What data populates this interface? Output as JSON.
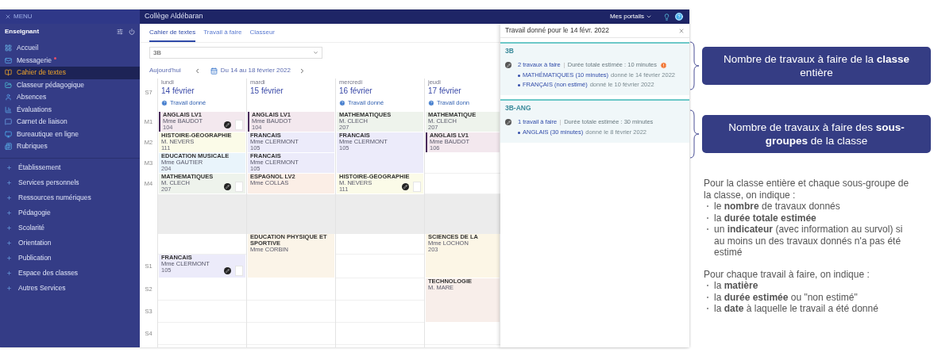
{
  "menu_button": "MENU",
  "school": "Collège Aldébaran",
  "portals": "Mes portails",
  "sidebar": {
    "role": "Enseignant",
    "items": [
      {
        "label": "Accueil",
        "selected": false,
        "badge": false
      },
      {
        "label": "Messagerie",
        "selected": false,
        "badge": true
      },
      {
        "label": "Cahier de textes",
        "selected": true,
        "badge": false
      },
      {
        "label": "Classeur pédagogique",
        "selected": false,
        "badge": false
      },
      {
        "label": "Absences",
        "selected": false,
        "badge": false
      },
      {
        "label": "Évaluations",
        "selected": false,
        "badge": false
      },
      {
        "label": "Carnet de liaison",
        "selected": false,
        "badge": false
      },
      {
        "label": "Bureautique en ligne",
        "selected": false,
        "badge": false
      },
      {
        "label": "Rubriques",
        "selected": false,
        "badge": false
      }
    ],
    "sections": [
      {
        "label": "Établissement",
        "expanded": false
      },
      {
        "label": "Services personnels",
        "expanded": false
      },
      {
        "label": "Ressources numériques",
        "expanded": false
      },
      {
        "label": "Pédagogie",
        "expanded": false
      },
      {
        "label": "Scolarité",
        "expanded": false
      },
      {
        "label": "Orientation",
        "expanded": false
      },
      {
        "label": "Publication",
        "expanded": false
      },
      {
        "label": "Espace des classes",
        "expanded": false
      },
      {
        "label": "Autres Services",
        "expanded": false
      }
    ]
  },
  "tabs": [
    {
      "label": "Cahier de textes",
      "selected": true
    },
    {
      "label": "Travail à faire",
      "selected": false
    },
    {
      "label": "Classeur",
      "selected": false
    }
  ],
  "class_select": {
    "value": "3B"
  },
  "nav": {
    "today": "Aujourd'hui",
    "range": "Du 14 au 18 février 2022"
  },
  "calendar": {
    "week": "S7",
    "times": [
      "M1",
      "M2",
      "M3",
      "M4",
      "S1",
      "S2",
      "S3",
      "S4"
    ],
    "days": [
      {
        "weekday": "lundi",
        "date": "14 février",
        "work_link": "Travail donné",
        "cells": [
          {
            "kind": "course",
            "subject": "ANGLAIS LV1",
            "teacher": "Mme BAUDOT",
            "room": "104",
            "color": "#f3e8ee",
            "subgroup": true,
            "homework": true,
            "long": false
          },
          {
            "kind": "course",
            "subject": "HISTOIRE-GÉOGRAPHIE",
            "teacher": "M. NEVERS",
            "room": "111",
            "color": "#fbfbe8",
            "subgroup": false,
            "homework": false,
            "long": false
          },
          {
            "kind": "course",
            "subject": "EDUCATION MUSICALE",
            "teacher": "Mme GAUTIER",
            "room": "204",
            "color": "#e9f4fb",
            "subgroup": false,
            "homework": false,
            "long": false
          },
          {
            "kind": "course",
            "subject": "MATHEMATIQUES",
            "teacher": "M. CLECH",
            "room": "207",
            "color": "#eef3ec",
            "subgroup": false,
            "homework": true,
            "long": false
          },
          {
            "kind": "lunch"
          },
          {
            "kind": "free"
          },
          {
            "kind": "course",
            "subject": "FRANCAIS",
            "teacher": "Mme CLERMONT",
            "room": "105",
            "color": "#ecebfa",
            "subgroup": false,
            "homework": true,
            "long": false
          },
          {
            "kind": "free"
          },
          {
            "kind": "free"
          },
          {
            "kind": "free"
          }
        ]
      },
      {
        "weekday": "mardi",
        "date": "15 février",
        "cells": [
          {
            "kind": "course",
            "subject": "ANGLAIS LV1",
            "teacher": "Mme BAUDOT",
            "room": "104",
            "color": "#f3e8ee",
            "subgroup": true,
            "homework": false,
            "long": false
          },
          {
            "kind": "course",
            "subject": "FRANCAIS",
            "teacher": "Mme CLERMONT",
            "room": "105",
            "color": "#ecebfa",
            "subgroup": false,
            "homework": false,
            "long": false
          },
          {
            "kind": "course",
            "subject": "FRANCAIS",
            "teacher": "Mme CLERMONT",
            "room": "105",
            "color": "#ecebfa",
            "subgroup": false,
            "homework": false,
            "long": false
          },
          {
            "kind": "course",
            "subject": "ESPAGNOL LV2",
            "teacher": "Mme COLLAS",
            "color": "#fbeee6",
            "subgroup": false,
            "homework": false,
            "long": false
          },
          {
            "kind": "lunch"
          },
          {
            "kind": "course",
            "subject": "EDUCATION PHYSIQUE ET SPORTIVE",
            "teacher": "Mme CORBIN",
            "color": "#fbf4e8",
            "subgroup": false,
            "homework": false,
            "long": true
          },
          {
            "kind": "free"
          },
          {
            "kind": "free"
          },
          {
            "kind": "free"
          }
        ]
      },
      {
        "weekday": "mercredi",
        "date": "16 février",
        "work_link": "Travail donné",
        "cells": [
          {
            "kind": "course",
            "subject": "MATHEMATIQUES",
            "teacher": "M. CLECH",
            "room": "207",
            "color": "#eef3ec",
            "subgroup": false,
            "homework": false,
            "long": false
          },
          {
            "kind": "course",
            "subject": "FRANCAIS",
            "teacher": "Mme CLERMONT",
            "room": "105",
            "color": "#ecebfa",
            "subgroup": false,
            "homework": false,
            "long": true
          },
          {
            "kind": "course",
            "subject": "HISTOIRE-GÉOGRAPHIE",
            "teacher": "M. NEVERS",
            "room": "111",
            "color": "#fbfbe8",
            "subgroup": false,
            "homework": true,
            "long": false
          },
          {
            "kind": "lunch"
          },
          {
            "kind": "free"
          },
          {
            "kind": "free"
          },
          {
            "kind": "free"
          },
          {
            "kind": "free"
          },
          {
            "kind": "free"
          }
        ]
      },
      {
        "weekday": "jeudi",
        "date": "17 février",
        "work_link": "Travail donn",
        "cells": [
          {
            "kind": "course",
            "subject": "MATHEMATIQUE",
            "teacher": "M. CLECH",
            "room": "207",
            "color": "#eef3ec",
            "subgroup": false,
            "homework": false,
            "long": false
          },
          {
            "kind": "course",
            "subject": "ANGLAIS LV1",
            "teacher": "Mme BAUDOT",
            "room": "106",
            "color": "#f3e8ee",
            "subgroup": true,
            "homework": false,
            "long": false
          },
          {
            "kind": "free"
          },
          {
            "kind": "free"
          },
          {
            "kind": "lunch"
          },
          {
            "kind": "course",
            "subject": "SCIENCES DE LA",
            "teacher": "Mme LOCHON",
            "room": "203",
            "color": "#fcf6e6",
            "subgroup": false,
            "homework": false,
            "long": true
          },
          {
            "kind": "course",
            "subject": "TECHNOLOGIE",
            "teacher": "M. MARE",
            "color": "#f8eeea",
            "subgroup": false,
            "homework": false,
            "long": true
          },
          {
            "kind": "free"
          }
        ]
      }
    ]
  },
  "panel": {
    "title": "Travail donné pour le 14 févr. 2022",
    "groups": [
      {
        "name": "3B",
        "count": "2 travaux à faire",
        "duration": "Durée totale estimée : 10 minutes",
        "warning": true,
        "items": [
          {
            "subject": "MATHÉMATIQUES (10 minutes)",
            "given": "donné le 14 février 2022"
          },
          {
            "subject": "FRANÇAIS (non estimé)",
            "given": "donné le 10 février 2022"
          }
        ]
      },
      {
        "name": "3B-ANG",
        "count": "1 travail à faire",
        "duration": "Durée totale estimée : 30 minutes",
        "warning": false,
        "items": [
          {
            "subject": "ANGLAIS (30 minutes)",
            "given": "donné le 8 février 2022"
          }
        ]
      }
    ]
  },
  "annotations": {
    "boxes": [
      "Nombre de travaux à faire de la **classe** entière",
      "Nombre de travaux à faire des **sous-groupes** de la classe"
    ],
    "notes": [
      {
        "intro": "Pour la classe entière et chaque sous-groupe de la classe, on indique :",
        "points": [
          "le **nombre** de travaux donnés",
          "la **durée totale estimée**",
          "un **indicateur** (avec information au survol) si au moins un des travaux donnés n'a pas été estimé"
        ]
      },
      {
        "intro": "Pour chaque travail à faire, on indique :",
        "points": [
          "la **matière**",
          "la **durée estimée** ou \"non estimé\"",
          "la **date** à laquelle le travail a été donné"
        ]
      }
    ]
  }
}
